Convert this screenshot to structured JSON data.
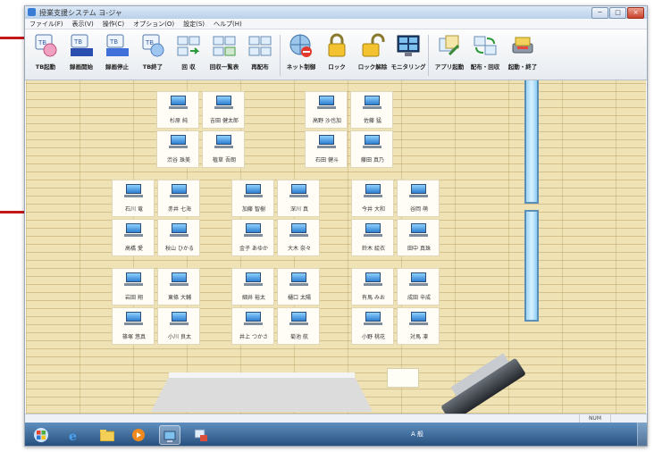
{
  "window": {
    "title": "授業支援システム ヨ-ジャ",
    "minimize": "─",
    "maximize": "□",
    "close": "×"
  },
  "menu": [
    "ファイル(F)",
    "表示(V)",
    "操作(C)",
    "オプション(O)",
    "設定(S)",
    "ヘルプ(H)"
  ],
  "toolbar": [
    {
      "label": "TB起動",
      "icon": "tb-start-icon"
    },
    {
      "label": "録画開始",
      "icon": "record-start-icon",
      "badge": "●REC"
    },
    {
      "label": "録画停止",
      "icon": "record-stop-icon",
      "badge": "STOP"
    },
    {
      "label": "TB終了",
      "icon": "tb-exit-icon"
    },
    {
      "label": "回 収",
      "icon": "collect-icon"
    },
    {
      "label": "回収一覧表",
      "icon": "collect-list-icon"
    },
    {
      "label": "再配布",
      "icon": "redistribute-icon"
    },
    {
      "label": "ネット制御",
      "icon": "network-control-icon"
    },
    {
      "label": "ロック",
      "icon": "lock-icon"
    },
    {
      "label": "ロック解除",
      "icon": "unlock-icon"
    },
    {
      "label": "モニタリング",
      "icon": "monitoring-icon"
    },
    {
      "label": "アプリ起動",
      "icon": "app-launch-icon"
    },
    {
      "label": "配布・回収",
      "icon": "distribute-collect-icon"
    },
    {
      "label": "起動・終了",
      "icon": "power-icon"
    }
  ],
  "students": [
    "杉原 純",
    "吉田 健太郎",
    "渋谷 珠美",
    "植草 吾朗",
    "高野 沙也加",
    "佐藤 猛",
    "石田 健斗",
    "藤田 真乃",
    "石川 竜",
    "赤井 七海",
    "高橋 愛",
    "秋山 ひかる",
    "加藤 智樹",
    "深川 真",
    "金子 あゆか",
    "大木 奈々",
    "今井 大和",
    "谷岡 萌",
    "鈴木 絵衣",
    "田中 真珠",
    "岩田 翔",
    "東條 大輔",
    "篠塚 悠真",
    "小川 良太",
    "細井 裕太",
    "樋口 太陽",
    "井上 つかさ",
    "菊池 航",
    "有馬 みお",
    "成田 辛成",
    "小野 桃花",
    "対馬 凛"
  ],
  "status": {
    "num": "NUM"
  },
  "tray_text": "A 般 ",
  "colors": {
    "callout": "#c2181c",
    "floor": "#efe2b5",
    "taskbar": "#27507e"
  }
}
